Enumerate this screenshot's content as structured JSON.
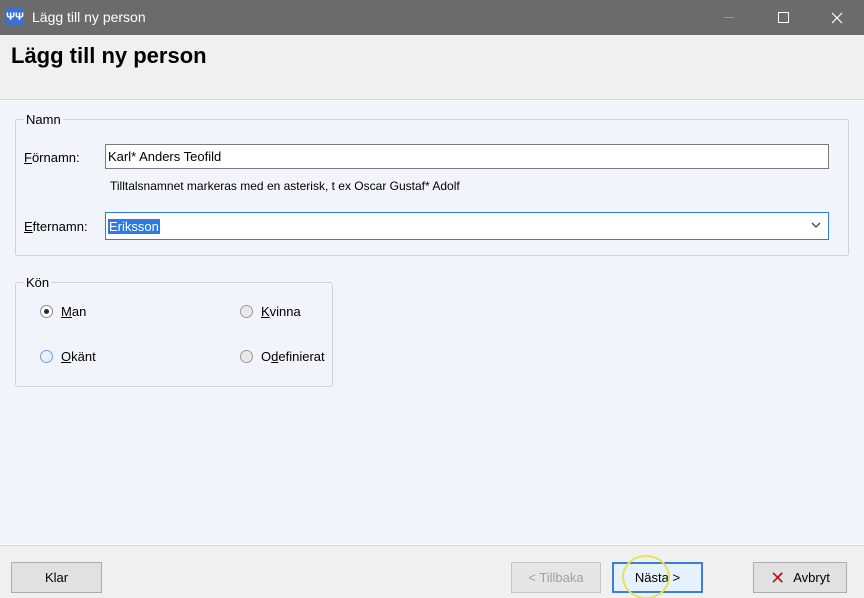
{
  "window": {
    "icon": "family-tree-icon",
    "title": "Lägg till ny person"
  },
  "header": {
    "heading": "Lägg till ny person"
  },
  "namn_group": {
    "legend": "Namn",
    "fornamn_label_u": "F",
    "fornamn_label_rest": "örnamn:",
    "fornamn_value": "Karl* Anders Teofild",
    "hint": "Tilltalsnamnet markeras med en asterisk, t ex  Oscar Gustaf* Adolf",
    "efternamn_label_u": "E",
    "efternamn_label_rest": "fternamn:",
    "efternamn_value": "Eriksson"
  },
  "kon_group": {
    "legend": "Kön",
    "options": [
      {
        "u": "M",
        "rest": "an",
        "selected": true
      },
      {
        "u": "K",
        "rest": "vinna",
        "selected": false
      },
      {
        "u": "O",
        "rest": "känt",
        "selected": false
      },
      {
        "pre": "O",
        "u": "d",
        "rest": "efinierat",
        "selected": false
      }
    ]
  },
  "buttons": {
    "klar": "Klar",
    "tillbaka": "< Tillbaka",
    "nasta": "Nästa >",
    "avbryt": "Avbryt"
  }
}
